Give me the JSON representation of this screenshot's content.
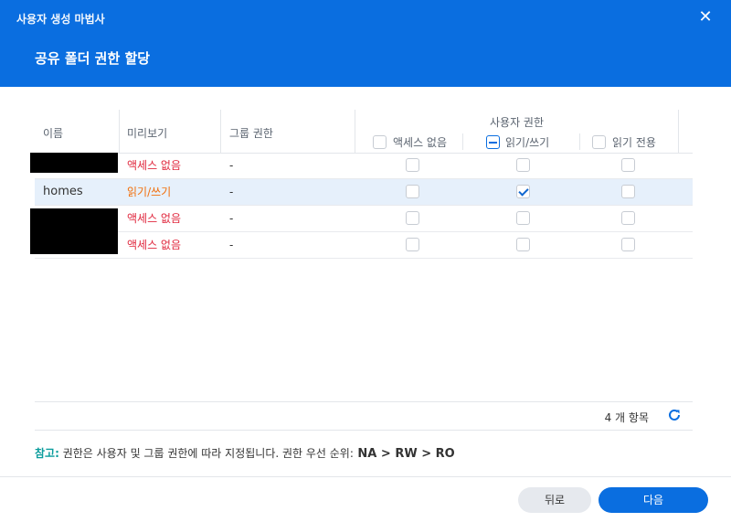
{
  "window": {
    "app_title": "사용자 생성 마법사",
    "close_icon": "close-icon"
  },
  "step": {
    "title": "공유 폴더 권한 할당"
  },
  "table": {
    "headers": {
      "name": "이름",
      "preview": "미리보기",
      "group": "그룹 권한",
      "user_perm": "사용자 권한",
      "no_access": "액세스 없음",
      "read_write": "읽기/쓰기",
      "read_only": "읽기 전용"
    },
    "rows": [
      {
        "name": "",
        "preview": "액세스 없음",
        "group": "-"
      },
      {
        "name": "homes",
        "preview": "읽기/쓰기",
        "group": "-"
      },
      {
        "name": "",
        "preview": "액세스 없음",
        "group": "-"
      },
      {
        "name": "",
        "preview": "액세스 없음",
        "group": "-"
      }
    ],
    "count_label": "4 개 항목"
  },
  "note": {
    "label": "참고:",
    "text": " 권한은 사용자 및 그룹 권한에 따라 지정됩니다. 권한 우선 순위:",
    "sequence": " NA > RW > RO"
  },
  "buttons": {
    "back": "뒤로",
    "next": "다음"
  },
  "colors": {
    "accent": "#0a6ee0",
    "no_access": "#e0283e",
    "read_write": "#f26e0a"
  }
}
